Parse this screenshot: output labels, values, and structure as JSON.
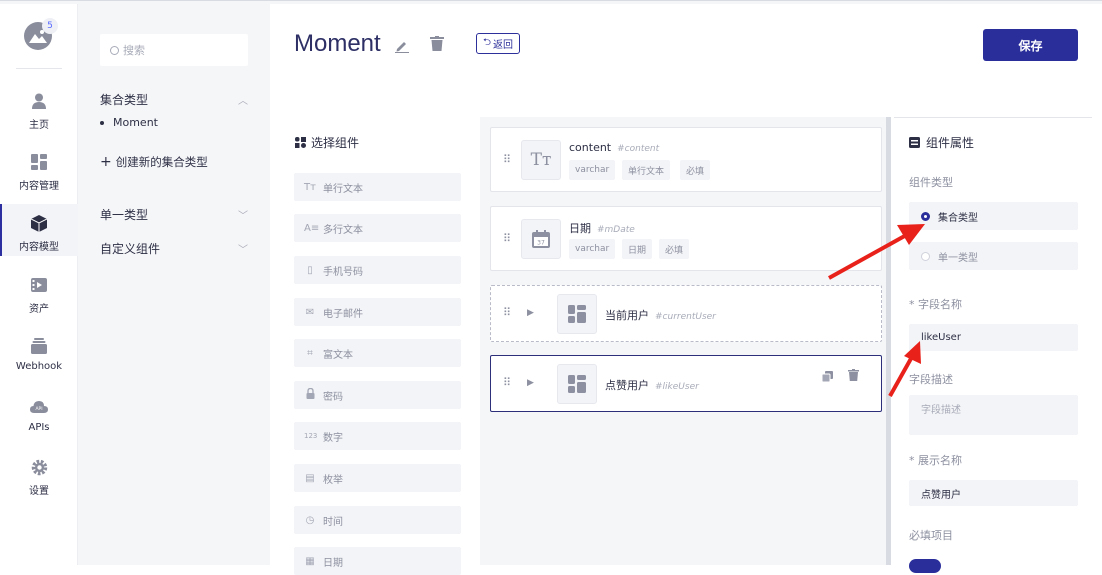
{
  "rail": {
    "badge": "5",
    "items": [
      {
        "label": "主页",
        "icon": "user-icon"
      },
      {
        "label": "内容管理",
        "icon": "dashboard-icon"
      },
      {
        "label": "内容模型",
        "icon": "cube-icon"
      },
      {
        "label": "资产",
        "icon": "media-icon"
      },
      {
        "label": "Webhook",
        "icon": "stack-icon"
      },
      {
        "label": "APIs",
        "icon": "api-cloud-icon"
      },
      {
        "label": "设置",
        "icon": "gear-icon"
      }
    ]
  },
  "sidebar": {
    "search_placeholder": "搜索",
    "collection_header": "集合类型",
    "collection_items": [
      "Moment"
    ],
    "create_collection": "创建新的集合类型",
    "single_header": "单一类型",
    "custom_header": "自定义组件"
  },
  "header": {
    "title": "Moment",
    "back_label": "返回",
    "save_label": "保存"
  },
  "picker": {
    "title": "选择组件",
    "items": [
      {
        "label": "单行文本",
        "glyph": "Tт"
      },
      {
        "label": "多行文本",
        "glyph": "A≡"
      },
      {
        "label": "手机号码",
        "glyph": "▯"
      },
      {
        "label": "电子邮件",
        "glyph": "✉"
      },
      {
        "label": "富文本",
        "glyph": "⌗"
      },
      {
        "label": "密码",
        "glyph": "🔒"
      },
      {
        "label": "数字",
        "glyph": "123"
      },
      {
        "label": "枚举",
        "glyph": "▤"
      },
      {
        "label": "时间",
        "glyph": "◷"
      },
      {
        "label": "日期",
        "glyph": "▦"
      }
    ]
  },
  "fields": [
    {
      "name": "content",
      "key": "#content",
      "tags": [
        "varchar",
        "单行文本",
        "必填"
      ]
    },
    {
      "name": "日期",
      "key": "#mDate",
      "tags": [
        "varchar",
        "日期",
        "必填"
      ],
      "icon_text": "37"
    },
    {
      "name": "当前用户",
      "key": "#currentUser"
    },
    {
      "name": "点赞用户",
      "key": "#likeUser"
    }
  ],
  "props": {
    "title": "组件属性",
    "type_label": "组件类型",
    "type_options": [
      "集合类型",
      "单一类型"
    ],
    "selected_type": "集合类型",
    "field_name_label": "* 字段名称",
    "field_name_value": "likeUser",
    "field_desc_label": "字段描述",
    "field_desc_placeholder": "字段描述",
    "display_name_label": "* 展示名称",
    "display_name_value": "点赞用户",
    "required_label": "必填项目",
    "required_on": true
  },
  "colors": {
    "primary": "#2a2e9b",
    "arrow": "#e8211a"
  }
}
